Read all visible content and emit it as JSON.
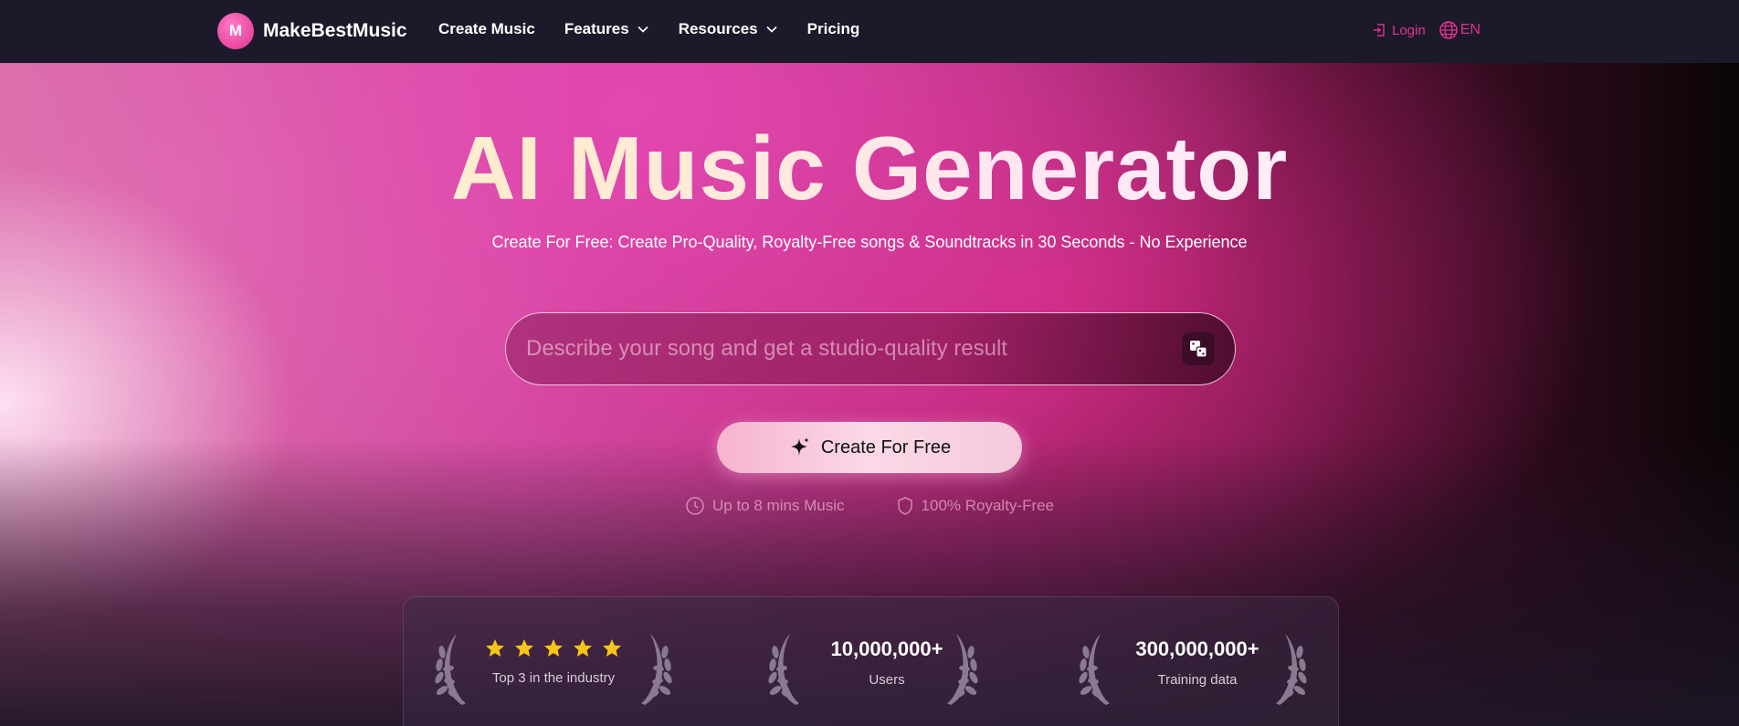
{
  "nav": {
    "brand_name": "MakeBestMusic",
    "brand_logo_text": "M",
    "links": [
      {
        "label": "Create Music",
        "has_dropdown": false
      },
      {
        "label": "Features",
        "has_dropdown": true
      },
      {
        "label": "Resources",
        "has_dropdown": true
      },
      {
        "label": "Pricing",
        "has_dropdown": false
      }
    ],
    "login_label": "Login",
    "lang_label": "EN"
  },
  "hero": {
    "title": "AI Music Generator",
    "subtitle": "Create For Free: Create Pro-Quality, Royalty-Free songs & Soundtracks in 30 Seconds - No Experience",
    "prompt_placeholder": "Describe your song and get a studio-quality result",
    "prompt_value": "",
    "cta_label": "Create For Free",
    "features": [
      {
        "icon": "clock-icon",
        "label": "Up to 8 mins Music"
      },
      {
        "icon": "shield-icon",
        "label": "100% Royalty-Free"
      }
    ]
  },
  "stats": [
    {
      "type": "rating",
      "stars": 5,
      "label": "Top 3 in the industry"
    },
    {
      "type": "number",
      "value": "10,000,000+",
      "label": "Users"
    },
    {
      "type": "number",
      "value": "300,000,000+",
      "label": "Training data"
    }
  ],
  "colors": {
    "accent": "#e0338f",
    "nav_bg": "#1c1a2a",
    "star": "#f5c518",
    "cta_bg": "#fbd9e7"
  }
}
